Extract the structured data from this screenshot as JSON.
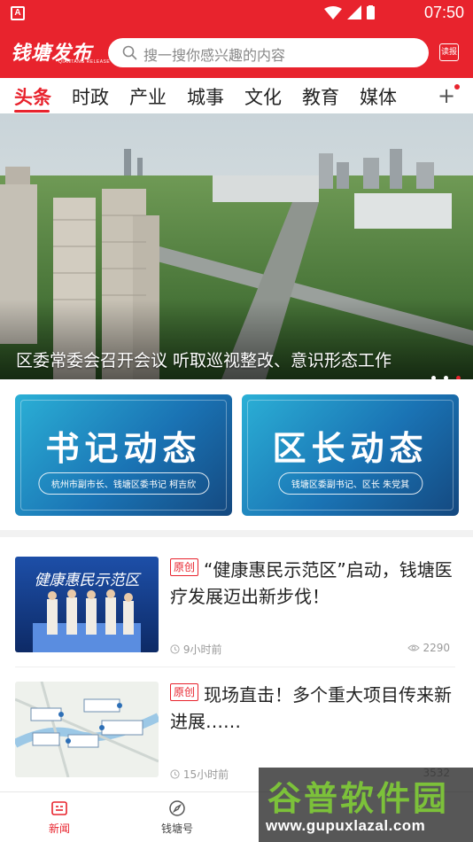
{
  "status_bar": {
    "time": "07:50",
    "notif_letter": "A"
  },
  "header": {
    "logo": "钱塘发布",
    "logo_sub": "QIANTANG RELEASE",
    "search_placeholder": "搜一搜你感兴趣的内容",
    "read_button": "读报"
  },
  "tabs": [
    {
      "label": "头条",
      "active": true
    },
    {
      "label": "时政"
    },
    {
      "label": "产业"
    },
    {
      "label": "城事"
    },
    {
      "label": "文化"
    },
    {
      "label": "教育"
    },
    {
      "label": "媒体"
    }
  ],
  "tab_more": "+",
  "banner": {
    "caption": "区委常委会召开会议 听取巡视整改、意识形态工作",
    "slide_count": 3,
    "active_slide": 3
  },
  "cards": [
    {
      "title": "书记动态",
      "subtitle": "杭州市副市长、钱塘区委书记 柯吉欣"
    },
    {
      "title": "区长动态",
      "subtitle": "钱塘区委副书记、区长 朱党其"
    }
  ],
  "news": [
    {
      "tag": "原创",
      "title": "“健康惠民示范区”启动，钱塘医疗发展迈出新步伐！",
      "time": "9小时前",
      "views": "2290",
      "thumb_text": "健康惠民示范区"
    },
    {
      "tag": "原创",
      "title": "现场直击！多个重大项目传来新进展……",
      "time": "15小时前",
      "views": "3532"
    }
  ],
  "bottom_nav": [
    {
      "label": "新闻",
      "icon": "news-icon",
      "active": true
    },
    {
      "label": "钱塘号",
      "icon": "compass-icon"
    }
  ],
  "watermark": {
    "title": "谷普软件园",
    "url": "www.gupuxlazal.com"
  },
  "colors": {
    "brand_red": "#e8232d",
    "card_blue": "#1a73b4"
  }
}
